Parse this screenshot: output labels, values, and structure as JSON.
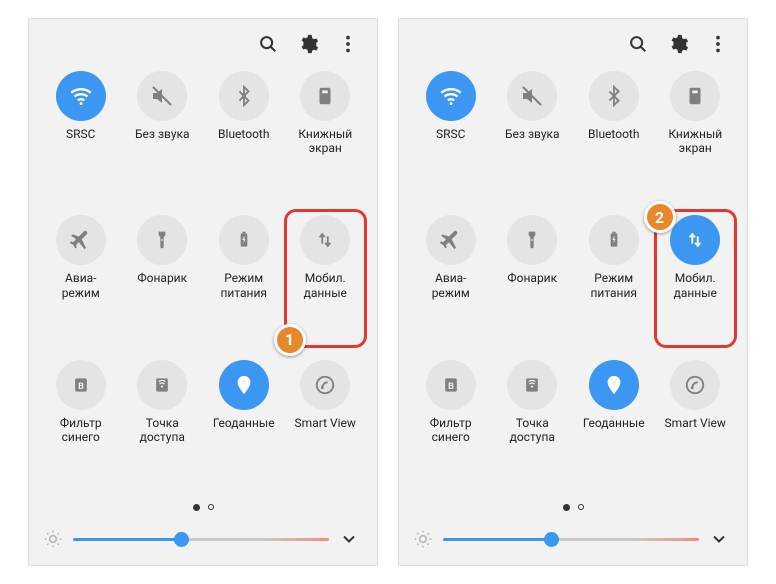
{
  "callouts": {
    "left": "1",
    "right": "2"
  },
  "tiles": [
    {
      "id": "wifi",
      "label": "SRSC",
      "icon": "wifi",
      "active": true
    },
    {
      "id": "mute",
      "label": "Без звука",
      "icon": "mute",
      "active": false
    },
    {
      "id": "bluetooth",
      "label": "Bluetooth",
      "icon": "bluetooth",
      "active": false
    },
    {
      "id": "book",
      "label": "Книжный\nэкран",
      "icon": "book",
      "active": false
    },
    {
      "id": "airplane",
      "label": "Авиа-\nрежим",
      "icon": "airplane",
      "active": false
    },
    {
      "id": "flashlight",
      "label": "Фонарик",
      "icon": "flashlight",
      "active": false
    },
    {
      "id": "power",
      "label": "Режим\nпитания",
      "icon": "battery",
      "active": false
    },
    {
      "id": "mobiledata",
      "label": "Мобил.\nданные",
      "icon": "updown",
      "active": false
    },
    {
      "id": "bluefilter",
      "label": "Фильтр\nсинего",
      "icon": "letter-b",
      "active": false
    },
    {
      "id": "hotspot",
      "label": "Точка\nдоступа",
      "icon": "hotspot",
      "active": false
    },
    {
      "id": "location",
      "label": "Геоданные",
      "icon": "pin",
      "active": true
    },
    {
      "id": "smartview",
      "label": "Smart View",
      "icon": "cast",
      "active": false
    }
  ],
  "brightness": {
    "value": 42
  },
  "panels": [
    {
      "highlight": "mobiledata",
      "mobileActive": false,
      "calloutPos": "bottom-left"
    },
    {
      "highlight": "mobiledata",
      "mobileActive": true,
      "calloutPos": "top-left"
    }
  ]
}
